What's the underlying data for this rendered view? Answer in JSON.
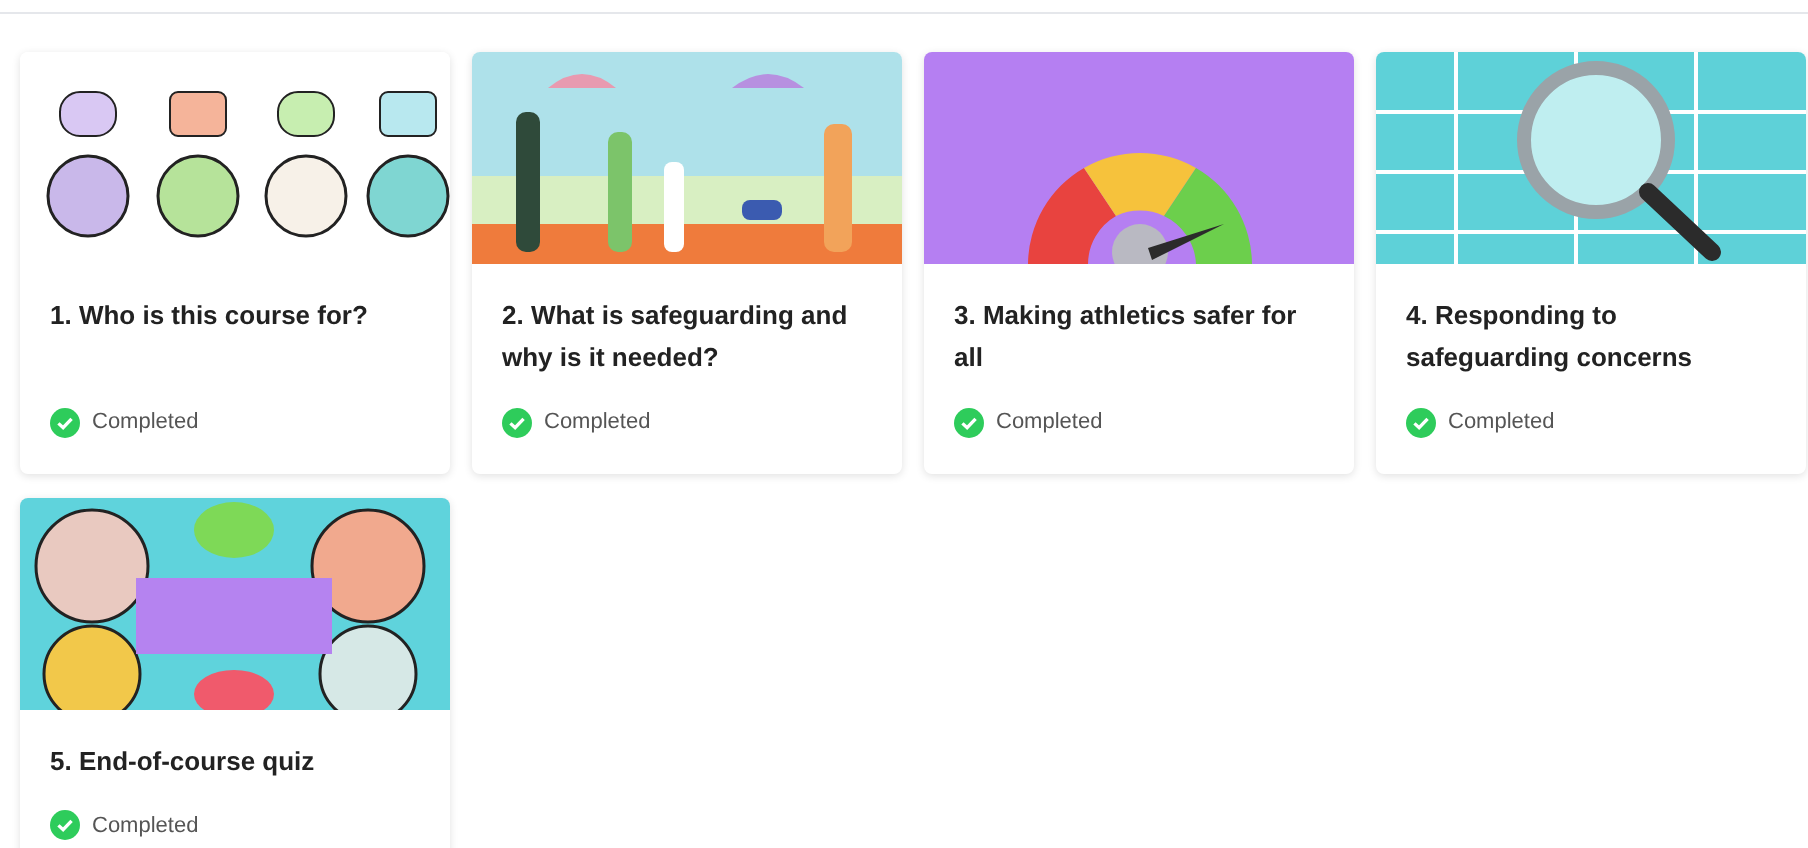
{
  "lessons": [
    {
      "title": "1. Who is this course for?",
      "status": "Completed",
      "completed": true
    },
    {
      "title": "2. What is safeguarding and why is it needed?",
      "status": "Completed",
      "completed": true
    },
    {
      "title": "3. Making athletics safer for all",
      "status": "Completed",
      "completed": true
    },
    {
      "title": "4. Responding to safeguarding concerns",
      "status": "Completed",
      "completed": true
    },
    {
      "title": "5. End-of-course quiz",
      "status": "Completed",
      "completed": true
    }
  ]
}
